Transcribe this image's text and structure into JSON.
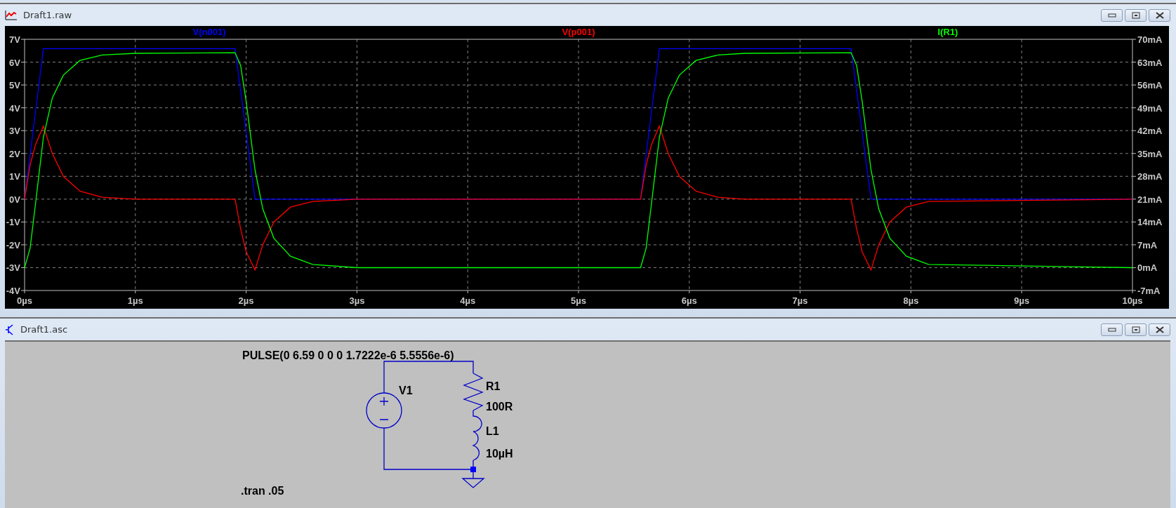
{
  "plot_window": {
    "title": "Draft1.raw",
    "chart_data": {
      "type": "line",
      "grid": true,
      "xlim": [
        0,
        10
      ],
      "ylim": [
        -4,
        7
      ],
      "y2lim": [
        -7,
        70
      ],
      "xticks": [
        {
          "value": 0,
          "label": "0µs"
        },
        {
          "value": 1,
          "label": "1µs"
        },
        {
          "value": 2,
          "label": "2µs"
        },
        {
          "value": 3,
          "label": "3µs"
        },
        {
          "value": 4,
          "label": "4µs"
        },
        {
          "value": 5,
          "label": "5µs"
        },
        {
          "value": 6,
          "label": "6µs"
        },
        {
          "value": 7,
          "label": "7µs"
        },
        {
          "value": 8,
          "label": "8µs"
        },
        {
          "value": 9,
          "label": "9µs"
        },
        {
          "value": 10,
          "label": "10µs"
        }
      ],
      "yticks": [
        {
          "value": 7,
          "label": "7V"
        },
        {
          "value": 6,
          "label": "6V"
        },
        {
          "value": 5,
          "label": "5V"
        },
        {
          "value": 4,
          "label": "4V"
        },
        {
          "value": 3,
          "label": "3V"
        },
        {
          "value": 2,
          "label": "2V"
        },
        {
          "value": 1,
          "label": "1V"
        },
        {
          "value": 0,
          "label": "0V"
        },
        {
          "value": -1,
          "label": "-1V"
        },
        {
          "value": -2,
          "label": "-2V"
        },
        {
          "value": -3,
          "label": "-3V"
        },
        {
          "value": -4,
          "label": "-4V"
        }
      ],
      "y2ticks": [
        {
          "value": 70,
          "label": "70mA"
        },
        {
          "value": 63,
          "label": "63mA"
        },
        {
          "value": 56,
          "label": "56mA"
        },
        {
          "value": 49,
          "label": "49mA"
        },
        {
          "value": 42,
          "label": "42mA"
        },
        {
          "value": 35,
          "label": "35mA"
        },
        {
          "value": 28,
          "label": "28mA"
        },
        {
          "value": 21,
          "label": "21mA"
        },
        {
          "value": 14,
          "label": "14mA"
        },
        {
          "value": 7,
          "label": "7mA"
        },
        {
          "value": 0,
          "label": "0mA"
        },
        {
          "value": -7,
          "label": "-7mA"
        }
      ],
      "x": [
        0,
        0.05,
        0.1,
        0.17,
        0.25,
        0.35,
        0.5,
        0.7,
        1.0,
        1.9,
        1.95,
        2.0,
        2.08,
        2.15,
        2.25,
        2.4,
        2.6,
        3.0,
        5.56,
        5.61,
        5.66,
        5.73,
        5.81,
        5.91,
        6.06,
        6.26,
        6.5,
        7.46,
        7.51,
        7.56,
        7.64,
        7.71,
        7.81,
        7.96,
        8.16,
        10
      ],
      "series": [
        {
          "name": "V(n001)",
          "color": "#0000ff",
          "values": [
            0,
            1.94,
            3.88,
            6.59,
            6.59,
            6.59,
            6.59,
            6.59,
            6.59,
            6.59,
            4.76,
            2.93,
            0,
            0,
            0,
            0,
            0,
            0,
            0,
            1.94,
            3.88,
            6.59,
            6.59,
            6.59,
            6.59,
            6.59,
            6.59,
            6.59,
            4.76,
            2.93,
            0,
            0,
            0,
            0,
            0,
            0
          ]
        },
        {
          "name": "V(p001)",
          "color": "#ff0000",
          "values": [
            0,
            1.5,
            2.4,
            3.2,
            2.0,
            1.0,
            0.35,
            0.08,
            0,
            0,
            -1.3,
            -2.3,
            -3.1,
            -2.0,
            -1.0,
            -0.35,
            -0.1,
            0,
            0,
            1.5,
            2.4,
            3.2,
            2.0,
            1.0,
            0.35,
            0.08,
            0,
            0,
            -1.3,
            -2.3,
            -3.1,
            -2.0,
            -1.0,
            -0.35,
            -0.1,
            0
          ]
        },
        {
          "name": "I(R1)",
          "color": "#00ff00",
          "axis": "y2",
          "values": [
            0,
            6,
            20,
            40,
            52,
            59,
            63.5,
            65.2,
            65.7,
            65.9,
            62,
            51,
            30,
            18,
            9,
            3.5,
            1,
            0,
            0,
            6,
            20,
            40,
            52,
            59,
            63.5,
            65.2,
            65.7,
            65.9,
            62,
            51,
            30,
            18,
            9,
            3.5,
            1,
            0
          ]
        }
      ]
    }
  },
  "schematic_window": {
    "title": "Draft1.asc",
    "source_spec": "PULSE(0 6.59 0 0 0 1.7222e-6 5.5556e-6)",
    "components": [
      {
        "kind": "voltage_source",
        "name": "V1"
      },
      {
        "kind": "resistor",
        "name": "R1",
        "value": "100R"
      },
      {
        "kind": "inductor",
        "name": "L1",
        "value": "10µH"
      }
    ],
    "directive": ".tran .05"
  }
}
